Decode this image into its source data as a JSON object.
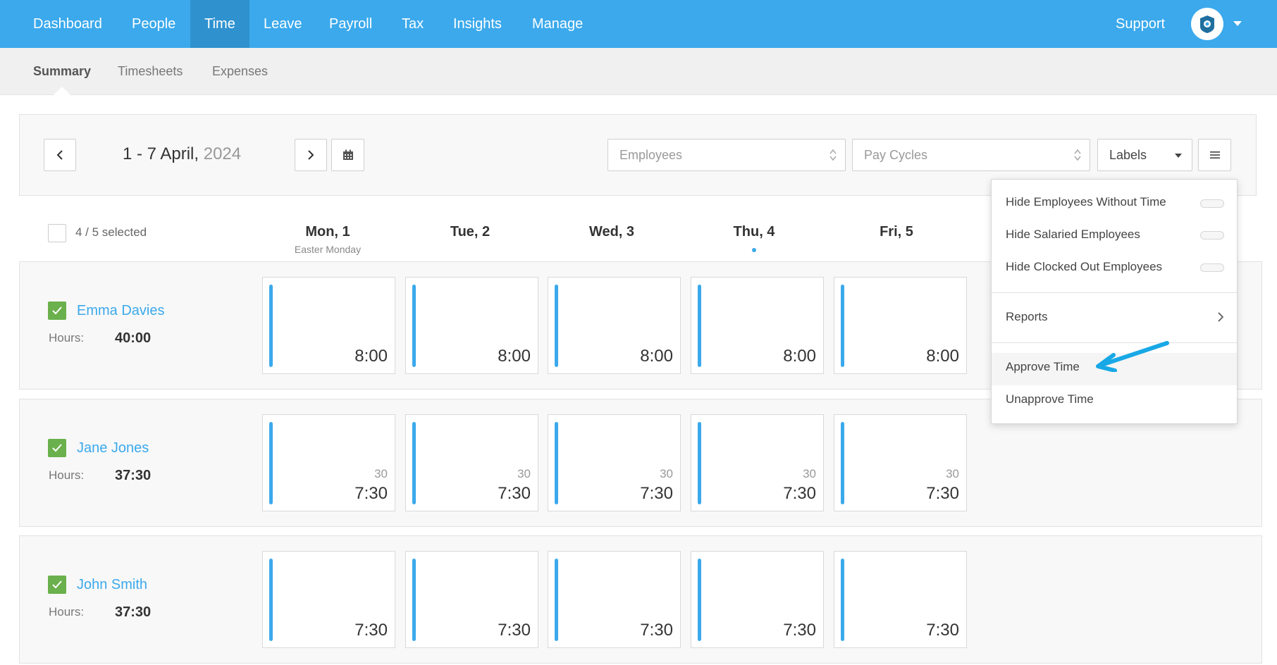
{
  "nav": {
    "items": [
      "Dashboard",
      "People",
      "Time",
      "Leave",
      "Payroll",
      "Tax",
      "Insights",
      "Manage"
    ],
    "active": "Time",
    "support": "Support",
    "accent": "#3ba9ec"
  },
  "subnav": {
    "items": [
      "Summary",
      "Timesheets",
      "Expenses"
    ],
    "active": "Summary"
  },
  "toolbar": {
    "date_range": "1 - 7 April,",
    "year": "2024",
    "employees_placeholder": "Employees",
    "pay_cycles_placeholder": "Pay Cycles",
    "labels": "Labels"
  },
  "header": {
    "selected": "4 / 5 selected",
    "days": [
      {
        "label": "Mon, 1",
        "sub": "Easter Monday"
      },
      {
        "label": "Tue, 2",
        "sub": ""
      },
      {
        "label": "Wed, 3",
        "sub": ""
      },
      {
        "label": "Thu, 4",
        "sub": ""
      },
      {
        "label": "Fri, 5",
        "sub": ""
      }
    ]
  },
  "hours_label": "Hours:",
  "employees": [
    {
      "name": "Emma Davies",
      "hours": "40:00",
      "days": [
        {
          "value": "8:00",
          "break": ""
        },
        {
          "value": "8:00",
          "break": ""
        },
        {
          "value": "8:00",
          "break": ""
        },
        {
          "value": "8:00",
          "break": ""
        },
        {
          "value": "8:00",
          "break": ""
        }
      ]
    },
    {
      "name": "Jane Jones",
      "hours": "37:30",
      "days": [
        {
          "value": "7:30",
          "break": "30"
        },
        {
          "value": "7:30",
          "break": "30"
        },
        {
          "value": "7:30",
          "break": "30"
        },
        {
          "value": "7:30",
          "break": "30"
        },
        {
          "value": "7:30",
          "break": "30"
        }
      ]
    },
    {
      "name": "John Smith",
      "hours": "37:30",
      "days": [
        {
          "value": "7:30",
          "break": ""
        },
        {
          "value": "7:30",
          "break": ""
        },
        {
          "value": "7:30",
          "break": ""
        },
        {
          "value": "7:30",
          "break": ""
        },
        {
          "value": "7:30",
          "break": ""
        }
      ]
    }
  ],
  "menu": {
    "toggles": [
      "Hide Employees Without Time",
      "Hide Salaried Employees",
      "Hide Clocked Out Employees"
    ],
    "reports": "Reports",
    "approve": "Approve Time",
    "unapprove": "Unapprove Time"
  }
}
